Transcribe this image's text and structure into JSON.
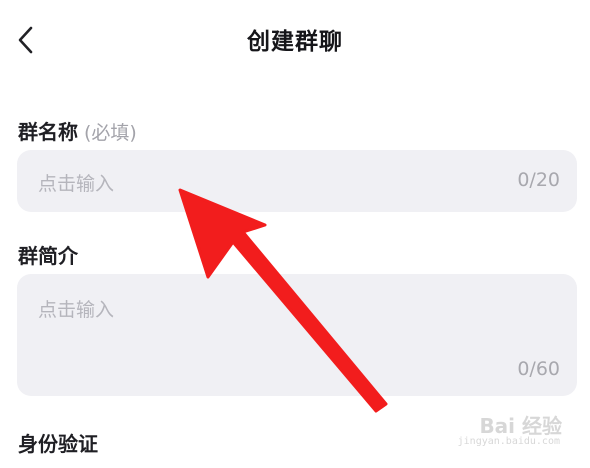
{
  "header": {
    "title": "创建群聊",
    "back_icon": "chevron-left-icon"
  },
  "group_name": {
    "label": "群名称",
    "hint": "(必填)",
    "placeholder": "点击输入",
    "counter": "0/20"
  },
  "group_intro": {
    "label": "群简介",
    "placeholder": "点击输入",
    "counter": "0/60"
  },
  "verification": {
    "label": "身份验证"
  },
  "annotation": {
    "arrow_color": "#f21d1d"
  },
  "watermark": {
    "text": "Bai 经验",
    "sub": "jingyan.baidu.com"
  }
}
